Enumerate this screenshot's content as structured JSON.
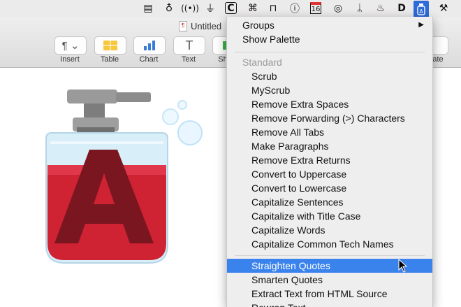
{
  "menubar": {
    "icons": [
      "card-icon",
      "lightbulb-icon",
      "wireless-icon",
      "broom-icon",
      "c-icon",
      "command-icon",
      "widget-icon",
      "info-icon",
      "calendar-icon",
      "compass-icon",
      "bird-icon",
      "flame-icon",
      "d-icon",
      "textsoap-icon",
      "tool-icon"
    ],
    "calendar_day": "16"
  },
  "window": {
    "title": "Untitled",
    "toolbar": [
      {
        "label": "Insert"
      },
      {
        "label": "Table"
      },
      {
        "label": "Chart"
      },
      {
        "label": "Text"
      },
      {
        "label": "Sh"
      },
      {
        "label": "ate"
      }
    ]
  },
  "menu": {
    "groups_label": "Groups",
    "show_palette_label": "Show Palette",
    "section_header": "Standard",
    "items": [
      "Scrub",
      "MyScrub",
      "Remove Extra Spaces",
      "Remove Forwarding (>) Characters",
      "Remove All Tabs",
      "Make Paragraphs",
      "Remove Extra Returns",
      "Convert to Uppercase",
      "Convert to Lowercase",
      "Capitalize Sentences",
      "Capitalize with Title Case",
      "Capitalize Words",
      "Capitalize Common Tech Names"
    ],
    "items2": [
      "Straighten Quotes",
      "Smarten Quotes",
      "Extract Text from HTML Source",
      "Rewrap Text"
    ],
    "highlighted": "Straighten Quotes"
  },
  "colors": {
    "highlight": "#3b83ec",
    "menubar_selected": "#2d6bd8",
    "app_icon_red": "#cf2233"
  }
}
